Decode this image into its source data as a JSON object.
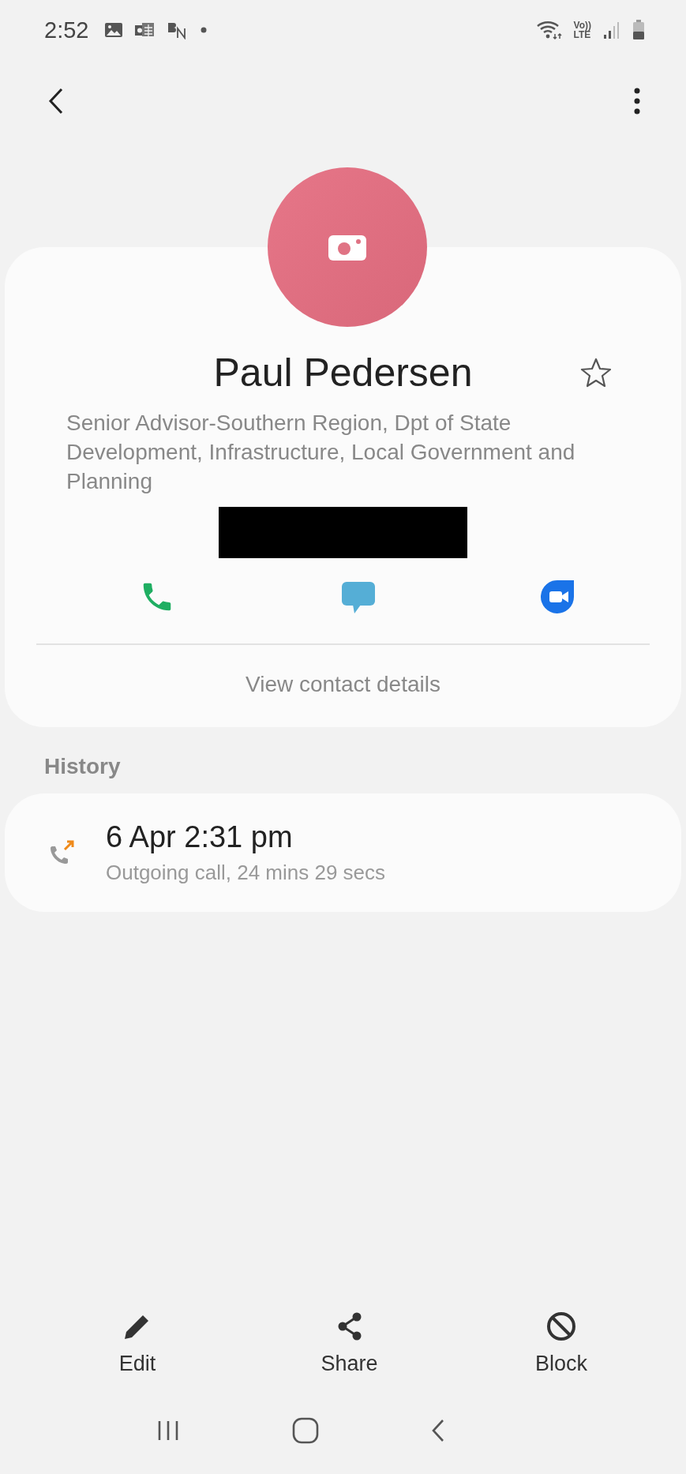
{
  "status_bar": {
    "time": "2:52",
    "volte_top": "Vo))",
    "volte_bottom": "LTE"
  },
  "contact": {
    "name": "Paul Pedersen",
    "starred": false,
    "title": "Senior Advisor-Southern Region, Dpt of State Development, Infrastructure, Local Government and Planning",
    "view_details": "View contact details"
  },
  "history": {
    "heading": "History",
    "entries": [
      {
        "time": "6 Apr 2:31 pm",
        "detail": "Outgoing call, 24 mins 29 secs"
      }
    ]
  },
  "bottom_actions": [
    {
      "kind": "edit",
      "label": "Edit"
    },
    {
      "kind": "share",
      "label": "Share"
    },
    {
      "kind": "block",
      "label": "Block"
    }
  ]
}
